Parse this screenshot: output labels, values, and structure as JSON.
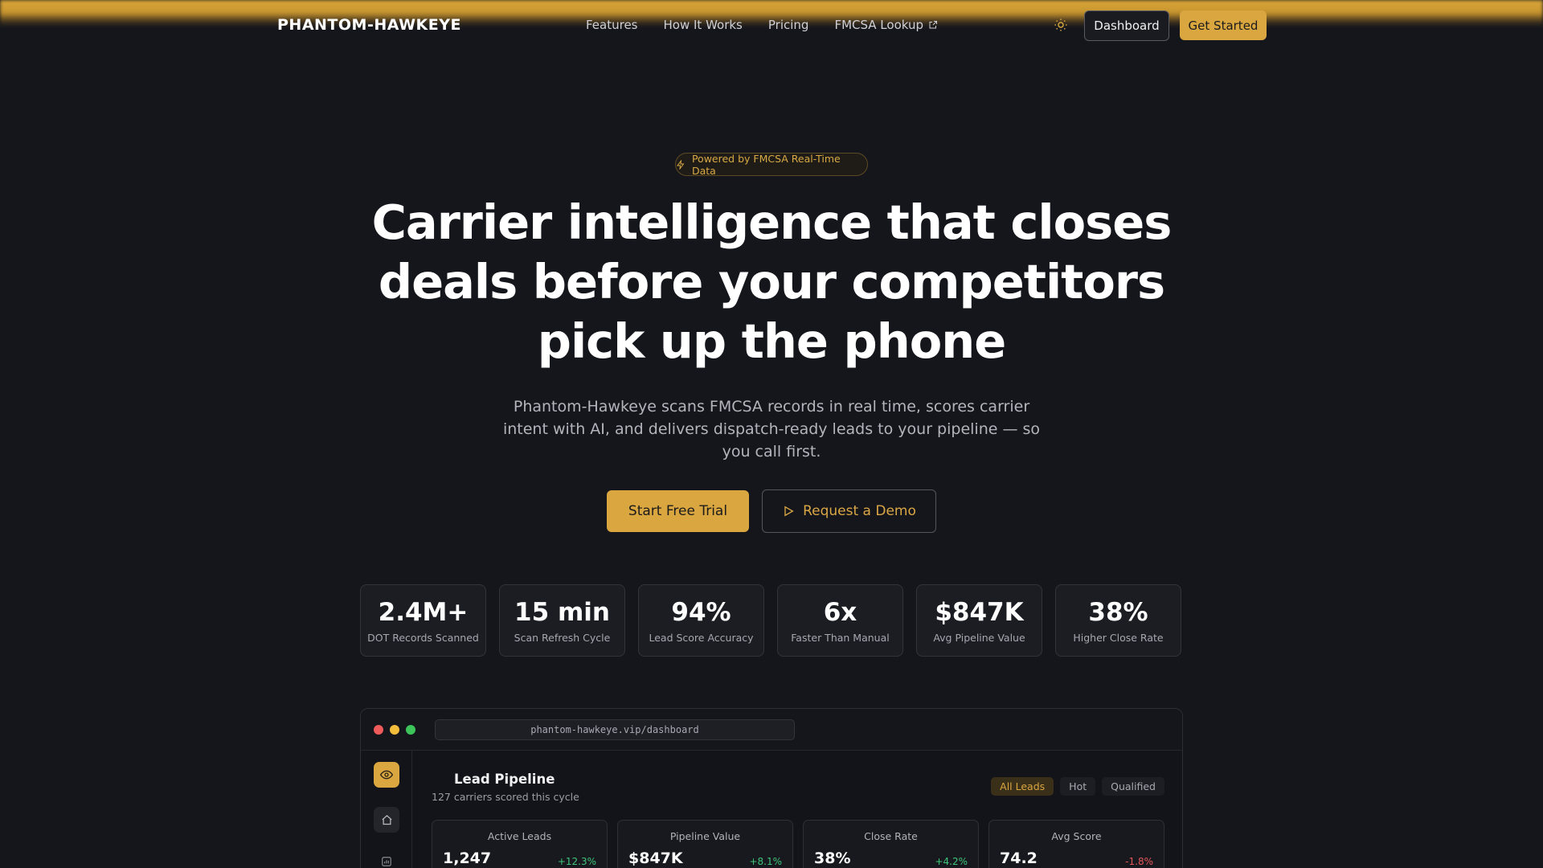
{
  "nav": {
    "logo": "PHANTOM-HAWKEYE",
    "links": [
      "Features",
      "How It Works",
      "Pricing",
      "FMCSA Lookup"
    ],
    "dashboard": "Dashboard",
    "get_started": "Get Started"
  },
  "hero": {
    "badge": "Powered by FMCSA Real-Time Data",
    "title_line1": "Carrier intelligence that closes",
    "title_line2": "deals before your competitors",
    "title_line3": "pick up the phone",
    "subtitle": "Phantom-Hawkeye scans FMCSA records in real time, scores carrier intent with AI, and delivers dispatch-ready leads to your pipeline — so you call first.",
    "cta_primary": "Start Free Trial",
    "cta_secondary": "Request a Demo"
  },
  "stats": [
    {
      "value": "2.4M+",
      "label": "DOT Records Scanned"
    },
    {
      "value": "15 min",
      "label": "Scan Refresh Cycle"
    },
    {
      "value": "94%",
      "label": "Lead Score Accuracy"
    },
    {
      "value": "6x",
      "label": "Faster Than Manual"
    },
    {
      "value": "$847K",
      "label": "Avg Pipeline Value"
    },
    {
      "value": "38%",
      "label": "Higher Close Rate"
    }
  ],
  "preview": {
    "url": "phantom-hawkeye.vip/dashboard",
    "title": "Lead Pipeline",
    "subtitle": "127 carriers scored this cycle",
    "filters": [
      "All Leads",
      "Hot",
      "Qualified"
    ],
    "kpis": [
      {
        "title": "Active Leads",
        "value": "1,247",
        "delta": "+12.3%",
        "trend": "up"
      },
      {
        "title": "Pipeline Value",
        "value": "$847K",
        "delta": "+8.1%",
        "trend": "up"
      },
      {
        "title": "Close Rate",
        "value": "38%",
        "delta": "+4.2%",
        "trend": "up"
      },
      {
        "title": "Avg Score",
        "value": "74.2",
        "delta": "-1.8%",
        "trend": "down"
      }
    ]
  },
  "colors": {
    "accent": "#d9a63f",
    "background": "#15161c",
    "positive": "#3ec47a",
    "negative": "#e2555a"
  },
  "icons": {
    "theme_toggle": "sun-icon",
    "external_link": "external-link-icon",
    "badge": "sparkle-icon",
    "demo": "play-icon",
    "sidebar": [
      "eye-icon",
      "home-icon",
      "chart-icon"
    ]
  }
}
